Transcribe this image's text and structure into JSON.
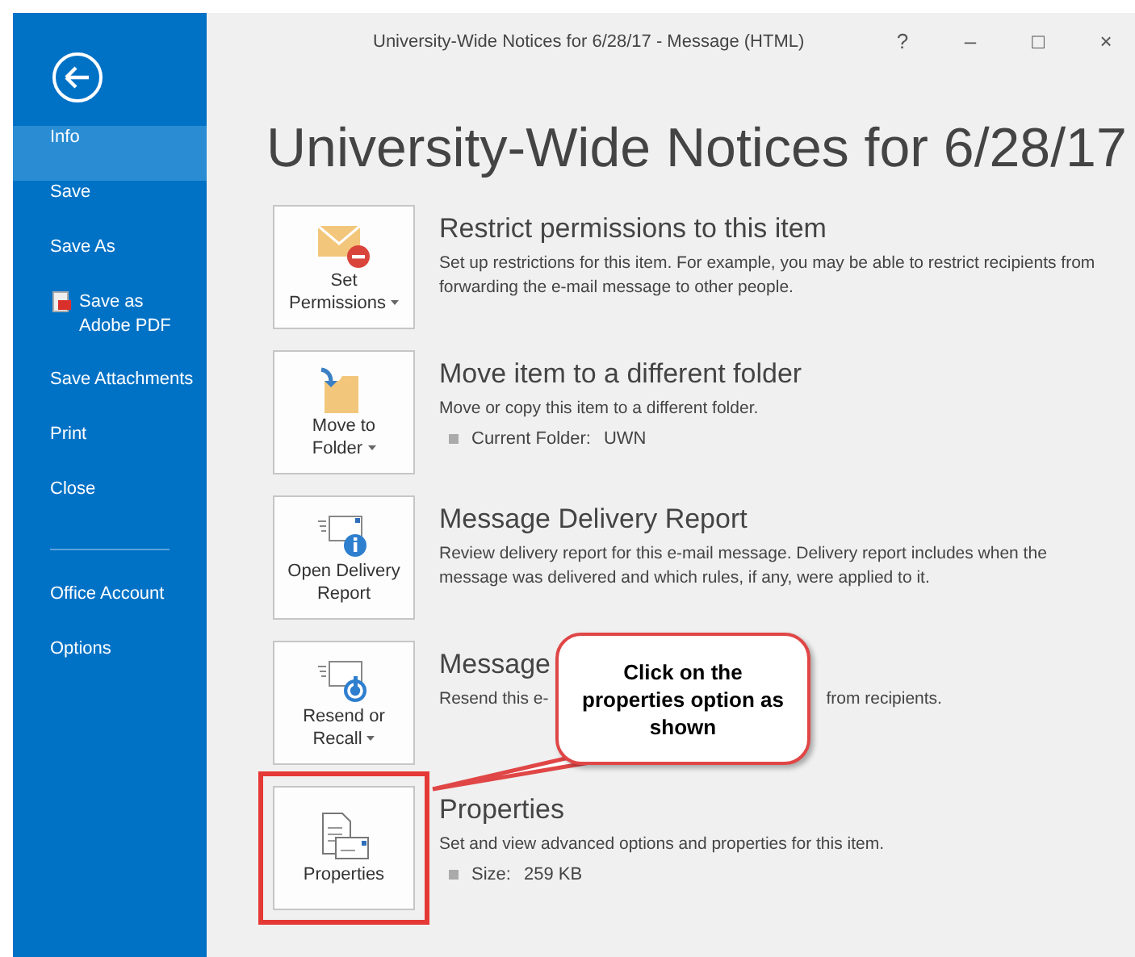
{
  "window": {
    "title": "University-Wide Notices for 6/28/17 - Message (HTML)",
    "controls": [
      "?",
      "–",
      "□",
      "×"
    ]
  },
  "sidebar": {
    "items": [
      {
        "label": "Info",
        "selected": true,
        "kind": "plain"
      },
      {
        "label": "Save",
        "selected": false,
        "kind": "plain"
      },
      {
        "label": "Save As",
        "selected": false,
        "kind": "plain"
      },
      {
        "label": "Save as Adobe PDF",
        "selected": false,
        "kind": "pdf"
      },
      {
        "label": "Save Attachments",
        "selected": false,
        "kind": "plain"
      },
      {
        "label": "Print",
        "selected": false,
        "kind": "plain"
      },
      {
        "label": "Close",
        "selected": false,
        "kind": "plain"
      }
    ],
    "footer_items": [
      {
        "label": "Office Account",
        "selected": false
      },
      {
        "label": "Options",
        "selected": false
      }
    ]
  },
  "heading": "University-Wide Notices for 6/28/17",
  "sections": [
    {
      "kind": "permissions",
      "button": [
        "Set",
        "Permissions"
      ],
      "dropdown": true,
      "highlighted": false,
      "title": "Restrict permissions to this item",
      "description": [
        "Set up restrictions for this item. For example, you may be able to restrict recipients from forwarding the e-mail message to other people."
      ]
    },
    {
      "kind": "move",
      "button": [
        "Move to",
        "Folder"
      ],
      "dropdown": true,
      "highlighted": false,
      "title": "Move item to a different folder",
      "description": [
        "Move or copy this item to a different folder."
      ],
      "detail": {
        "label": "Current Folder:",
        "value": "UWN"
      }
    },
    {
      "kind": "delivery",
      "button": [
        "Open Delivery",
        "Report"
      ],
      "dropdown": false,
      "highlighted": false,
      "title": "Message Delivery Report",
      "description": [
        "Review delivery report for this e-mail message. Delivery report includes when the message was delivered and which rules, if any, were applied to it."
      ]
    },
    {
      "kind": "recall",
      "button": [
        "Resend or",
        "Recall"
      ],
      "dropdown": true,
      "highlighted": false,
      "title": "Message",
      "description": [
        "Resend this e-",
        "from recipients."
      ]
    },
    {
      "kind": "properties",
      "button": [
        "Properties"
      ],
      "dropdown": false,
      "highlighted": true,
      "title": "Properties",
      "description": [
        "Set and view advanced options and properties for this item."
      ],
      "detail": {
        "label": "Size:",
        "value": "259 KB"
      }
    }
  ],
  "callout": "Click on the properties option as shown"
}
